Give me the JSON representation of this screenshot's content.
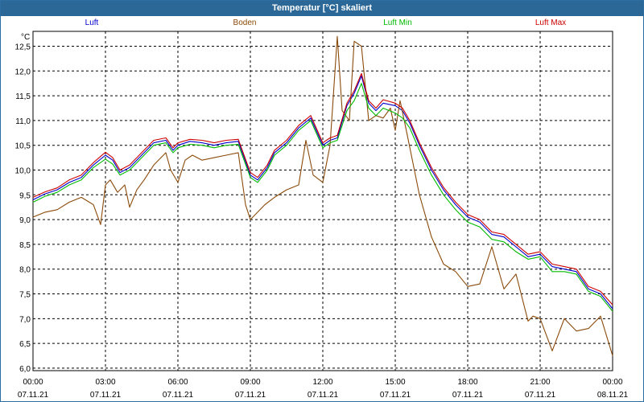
{
  "window": {
    "title": "Temperatur [°C] skaliert"
  },
  "chart_data": {
    "type": "line",
    "title": "Temperatur [°C] skaliert",
    "ylabel": "°C",
    "xlabel": "",
    "ylim": [
      5.95,
      12.8
    ],
    "yticks": [
      "6,0",
      "6,5",
      "7,0",
      "7,5",
      "8,0",
      "8,5",
      "9,0",
      "9,5",
      "10,0",
      "10,5",
      "11,0",
      "11,5",
      "12,0",
      "12,5"
    ],
    "xlim": [
      0,
      24
    ],
    "xticks": [
      {
        "time": "00:00",
        "date": "07.11.21"
      },
      {
        "time": "03:00",
        "date": "07.11.21"
      },
      {
        "time": "06:00",
        "date": "07.11.21"
      },
      {
        "time": "09:00",
        "date": "07.11.21"
      },
      {
        "time": "12:00",
        "date": "07.11.21"
      },
      {
        "time": "15:00",
        "date": "07.11.21"
      },
      {
        "time": "18:00",
        "date": "07.11.21"
      },
      {
        "time": "21:00",
        "date": "07.11.21"
      },
      {
        "time": "00:00",
        "date": "08.11.21"
      }
    ],
    "grid": true,
    "legend_position": "top",
    "series": [
      {
        "name": "Luft",
        "color": "#0000cc",
        "x": [
          0,
          0.5,
          1,
          1.5,
          2,
          2.5,
          3,
          3.3,
          3.6,
          4,
          4.5,
          5,
          5.5,
          5.8,
          6,
          6.5,
          7,
          7.5,
          8,
          8.5,
          9,
          9.3,
          9.7,
          10,
          10.5,
          11,
          11.5,
          12,
          12.3,
          12.6,
          13,
          13.3,
          13.6,
          13.9,
          14.2,
          14.5,
          15,
          15.3,
          15.6,
          16,
          16.5,
          17,
          17.5,
          18,
          18.5,
          19,
          19.5,
          20,
          20.5,
          21,
          21.5,
          22,
          22.5,
          23,
          23.5,
          24
        ],
        "y": [
          9.4,
          9.52,
          9.6,
          9.75,
          9.85,
          10.1,
          10.3,
          10.2,
          9.95,
          10.05,
          10.3,
          10.55,
          10.6,
          10.4,
          10.5,
          10.58,
          10.55,
          10.5,
          10.55,
          10.58,
          9.9,
          9.8,
          10.05,
          10.35,
          10.55,
          10.85,
          11.05,
          10.5,
          10.6,
          10.65,
          11.3,
          11.55,
          11.9,
          11.35,
          11.2,
          11.35,
          11.3,
          11.2,
          10.95,
          10.5,
          10,
          9.6,
          9.3,
          9.05,
          8.95,
          8.7,
          8.65,
          8.45,
          8.25,
          8.3,
          8.05,
          8,
          7.95,
          7.6,
          7.5,
          7.2
        ]
      },
      {
        "name": "Boden",
        "color": "#8b4a0a",
        "x": [
          0,
          0.5,
          1,
          1.5,
          2,
          2.5,
          2.8,
          3,
          3.2,
          3.5,
          3.8,
          4,
          4.3,
          4.6,
          5,
          5.5,
          5.7,
          6,
          6.3,
          6.6,
          7,
          7.5,
          8,
          8.5,
          8.8,
          9,
          9.3,
          9.6,
          10,
          10.5,
          11,
          11.3,
          11.6,
          12,
          12.3,
          12.6,
          12.8,
          13.1,
          13.3,
          13.6,
          13.9,
          14.2,
          14.5,
          14.8,
          15,
          15.2,
          15.5,
          16,
          16.5,
          17,
          17.5,
          18,
          18.5,
          19,
          19.5,
          20,
          20.5,
          20.7,
          21,
          21.5,
          22,
          22.5,
          23,
          23.5,
          24
        ],
        "y": [
          9.05,
          9.15,
          9.2,
          9.35,
          9.45,
          9.3,
          8.9,
          9.7,
          9.8,
          9.55,
          9.7,
          9.25,
          9.6,
          9.8,
          10.1,
          10.35,
          10.0,
          9.75,
          10.2,
          10.3,
          10.2,
          10.25,
          10.3,
          10.35,
          9.3,
          9.0,
          9.15,
          9.3,
          9.45,
          9.6,
          9.7,
          10.6,
          9.9,
          9.75,
          10.5,
          12.7,
          11.2,
          11.0,
          12.6,
          12.5,
          11.0,
          11.1,
          11.05,
          11.25,
          10.8,
          11.4,
          10.7,
          9.5,
          8.65,
          8.1,
          7.95,
          7.65,
          7.7,
          8.45,
          7.6,
          7.9,
          6.95,
          7.05,
          7.0,
          6.35,
          7.0,
          6.75,
          6.8,
          7.05,
          6.25
        ]
      },
      {
        "name": "Luft Min",
        "color": "#00bb00",
        "x": [
          0,
          0.5,
          1,
          1.5,
          2,
          2.5,
          3,
          3.3,
          3.6,
          4,
          4.5,
          5,
          5.5,
          5.8,
          6,
          6.5,
          7,
          7.5,
          8,
          8.5,
          9,
          9.3,
          9.7,
          10,
          10.5,
          11,
          11.5,
          12,
          12.3,
          12.6,
          13,
          13.3,
          13.6,
          13.9,
          14.2,
          14.5,
          15,
          15.3,
          15.6,
          16,
          16.5,
          17,
          17.5,
          18,
          18.5,
          19,
          19.5,
          20,
          20.5,
          21,
          21.5,
          22,
          22.5,
          23,
          23.5,
          24
        ],
        "y": [
          9.35,
          9.47,
          9.55,
          9.7,
          9.8,
          10.05,
          10.22,
          10.12,
          9.9,
          10.0,
          10.25,
          10.5,
          10.55,
          10.35,
          10.45,
          10.52,
          10.5,
          10.45,
          10.5,
          10.52,
          9.85,
          9.75,
          10.0,
          10.3,
          10.5,
          10.8,
          11.0,
          10.45,
          10.55,
          10.6,
          11.2,
          11.4,
          11.75,
          11.25,
          11.1,
          11.25,
          11.15,
          11.05,
          10.85,
          10.4,
          9.9,
          9.5,
          9.2,
          8.95,
          8.85,
          8.6,
          8.55,
          8.35,
          8.2,
          8.25,
          7.95,
          7.95,
          7.9,
          7.55,
          7.45,
          7.15
        ]
      },
      {
        "name": "Luft Max",
        "color": "#cc0000",
        "x": [
          0,
          0.5,
          1,
          1.5,
          2,
          2.5,
          3,
          3.3,
          3.6,
          4,
          4.5,
          5,
          5.5,
          5.8,
          6,
          6.5,
          7,
          7.5,
          8,
          8.5,
          9,
          9.3,
          9.7,
          10,
          10.5,
          11,
          11.5,
          12,
          12.3,
          12.6,
          13,
          13.3,
          13.6,
          13.9,
          14.2,
          14.5,
          15,
          15.3,
          15.6,
          16,
          16.5,
          17,
          17.5,
          18,
          18.5,
          19,
          19.5,
          20,
          20.5,
          21,
          21.5,
          22,
          22.5,
          23,
          23.5,
          24
        ],
        "y": [
          9.45,
          9.56,
          9.64,
          9.8,
          9.9,
          10.15,
          10.36,
          10.25,
          10.0,
          10.1,
          10.35,
          10.6,
          10.65,
          10.45,
          10.55,
          10.62,
          10.6,
          10.55,
          10.6,
          10.62,
          9.95,
          9.85,
          10.1,
          10.4,
          10.6,
          10.9,
          11.1,
          10.55,
          10.65,
          10.7,
          11.35,
          11.6,
          11.95,
          11.4,
          11.25,
          11.42,
          11.35,
          11.25,
          11.0,
          10.55,
          10.05,
          9.65,
          9.35,
          9.1,
          9.0,
          8.75,
          8.7,
          8.5,
          8.3,
          8.35,
          8.1,
          8.05,
          8.0,
          7.65,
          7.55,
          7.28
        ]
      }
    ]
  }
}
